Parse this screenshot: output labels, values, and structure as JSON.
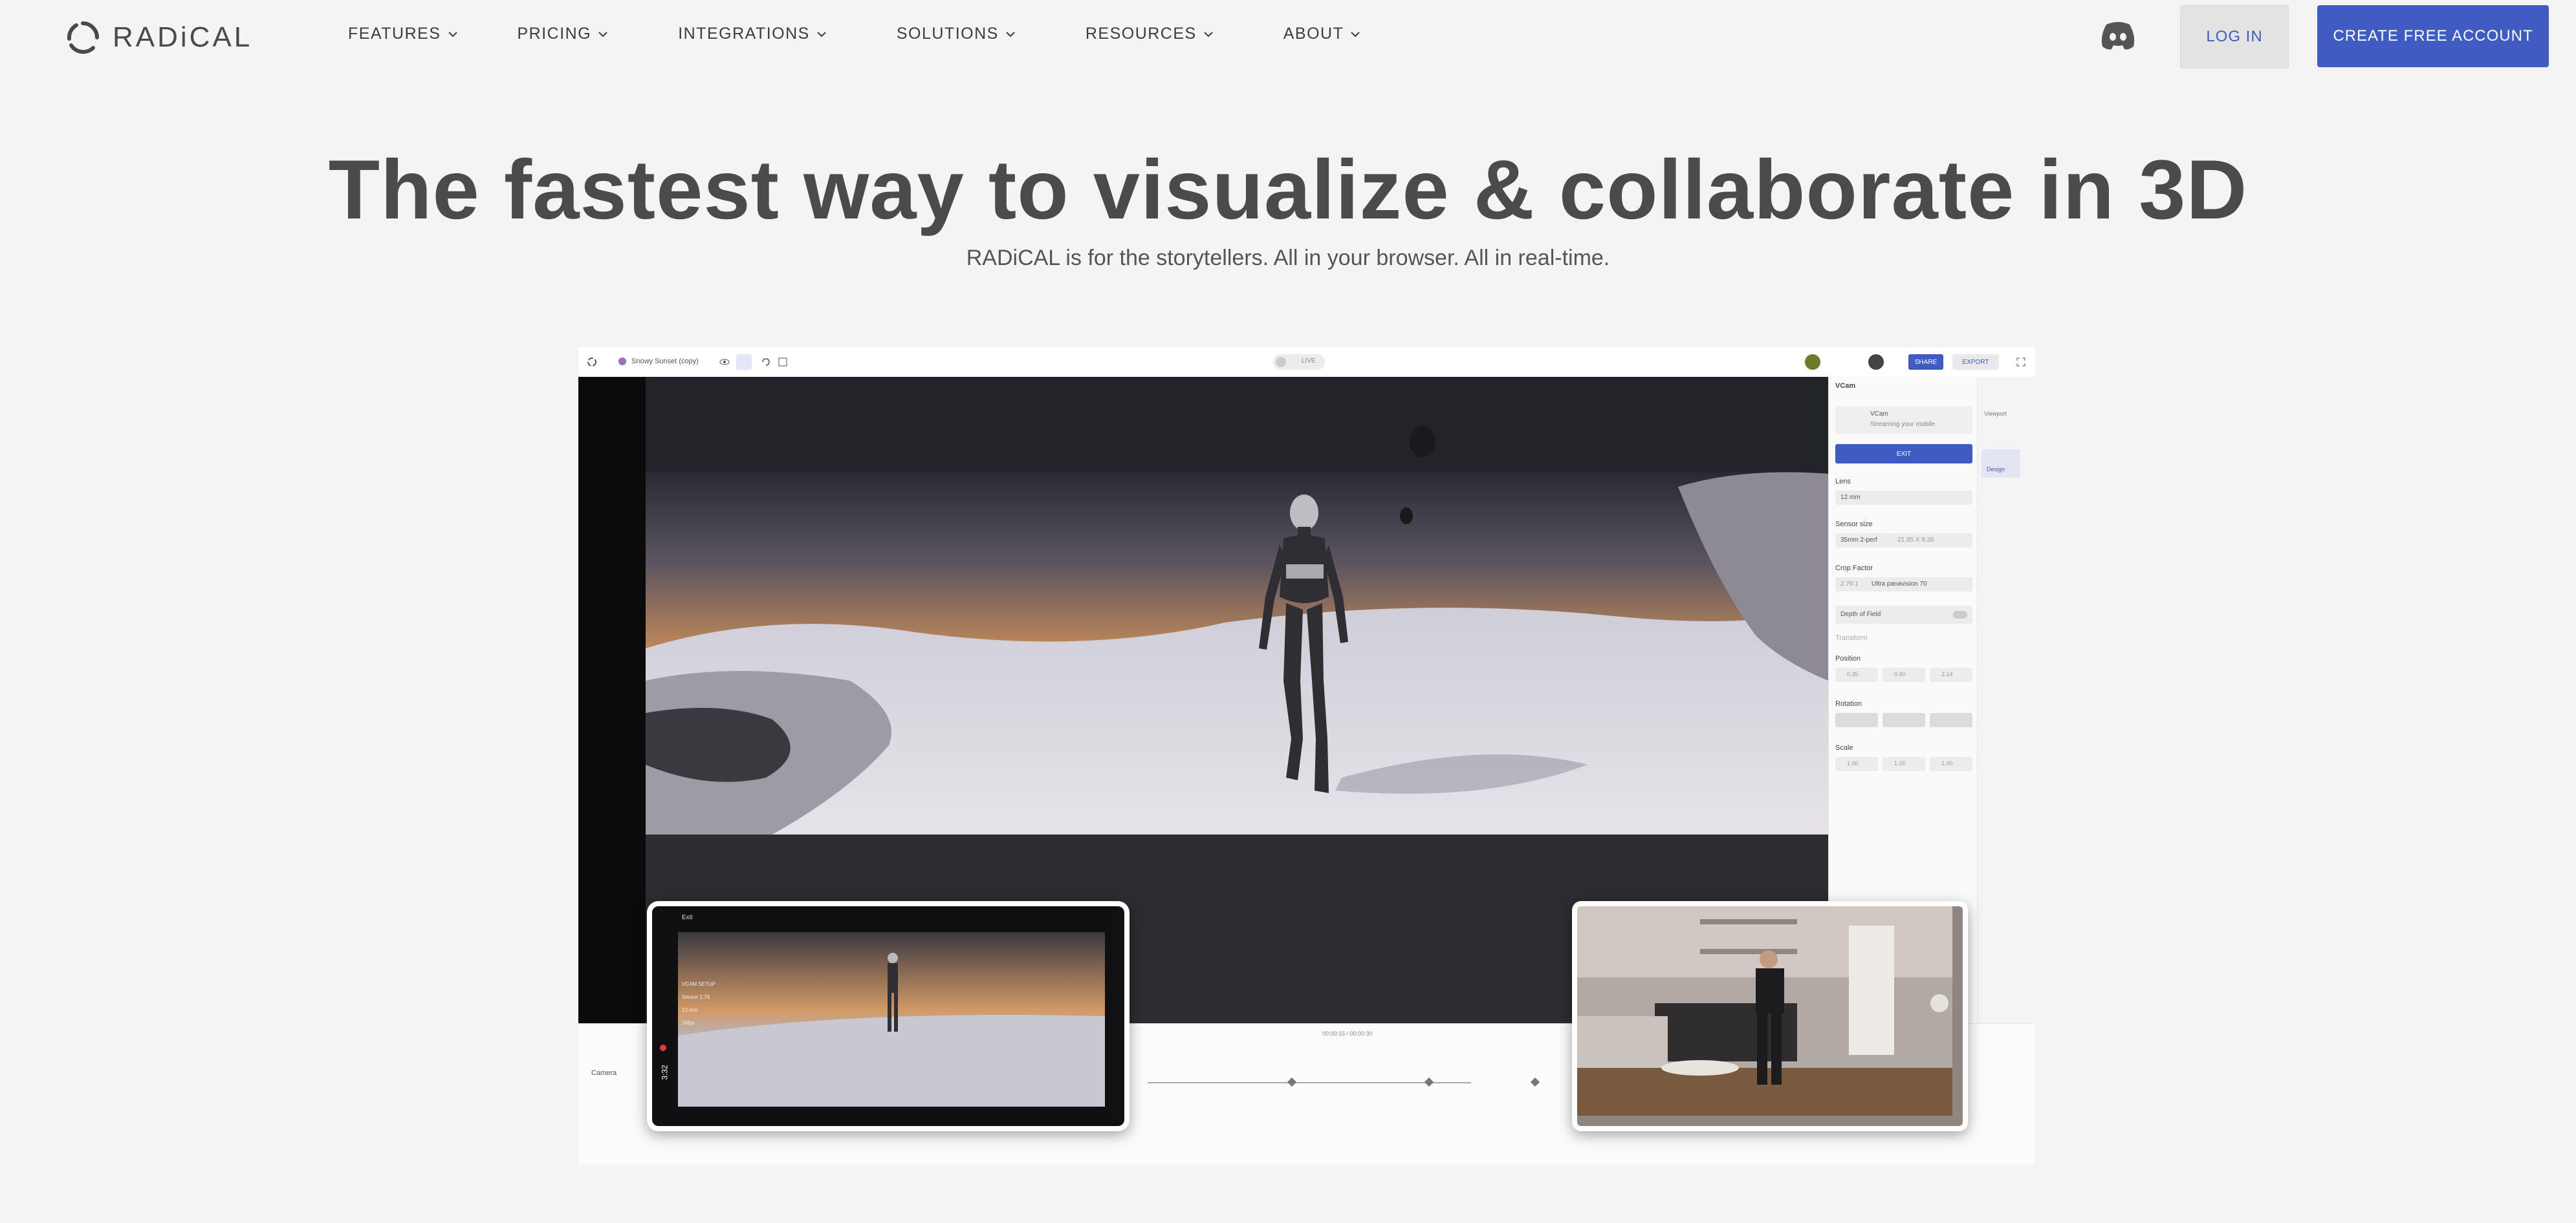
{
  "brand": {
    "name": "RADiCAL"
  },
  "nav": {
    "items": [
      {
        "label": "FEATURES"
      },
      {
        "label": "PRICING"
      },
      {
        "label": "INTEGRATIONS"
      },
      {
        "label": "SOLUTIONS"
      },
      {
        "label": "RESOURCES"
      },
      {
        "label": "ABOUT"
      }
    ],
    "login_label": "LOG IN",
    "create_label": "CREATE FREE ACCOUNT"
  },
  "hero": {
    "title": "The fastest way to visualize & collaborate in 3D",
    "subtitle": "RADiCAL is for the storytellers. All in your browser. All in real-time."
  },
  "app": {
    "project_name": "Snowy Sunset (copy)",
    "live_label": "LIVE",
    "share_label": "SHARE",
    "export_label": "EXPORT",
    "panel": {
      "title": "VCam",
      "vcam_name": "VCam",
      "vcam_status": "Streaming your mobile",
      "exit_label": "EXIT",
      "lens_label": "Lens",
      "lens_value": "12 mm",
      "sensor_label": "Sensor size",
      "sensor_value": "35mm 2-perf",
      "sensor_dims": "21.95 X 9.35",
      "crop_label": "Crop Factor",
      "crop_ratio": "2.76:1",
      "crop_value": "Ultra panavision 70",
      "dof_label": "Depth of Field",
      "transform_label": "Transform",
      "position_label": "Position",
      "position": {
        "x": "0.35",
        "y": "0.40",
        "z": "2.14"
      },
      "rotation_label": "Rotation",
      "scale_label": "Scale",
      "scale": {
        "x": "1.00",
        "y": "1.00",
        "z": "1.00"
      }
    },
    "rail": {
      "viewport_label": "Viewport",
      "design_label": "Design"
    },
    "timeline": {
      "track_label": "Camera",
      "time": "00:00:15 / 00:00:30"
    },
    "phone": {
      "exit_label": "Exit",
      "time": "3:32",
      "hud_title": "VCAM SETUP",
      "hud_sensor": "Sensor 2.76",
      "hud_lens": "12 mm",
      "hud_fps": "24fps"
    }
  },
  "colors": {
    "accent": "#3e5cc2",
    "background": "#f4f4f4",
    "text": "#4b4b4b"
  }
}
